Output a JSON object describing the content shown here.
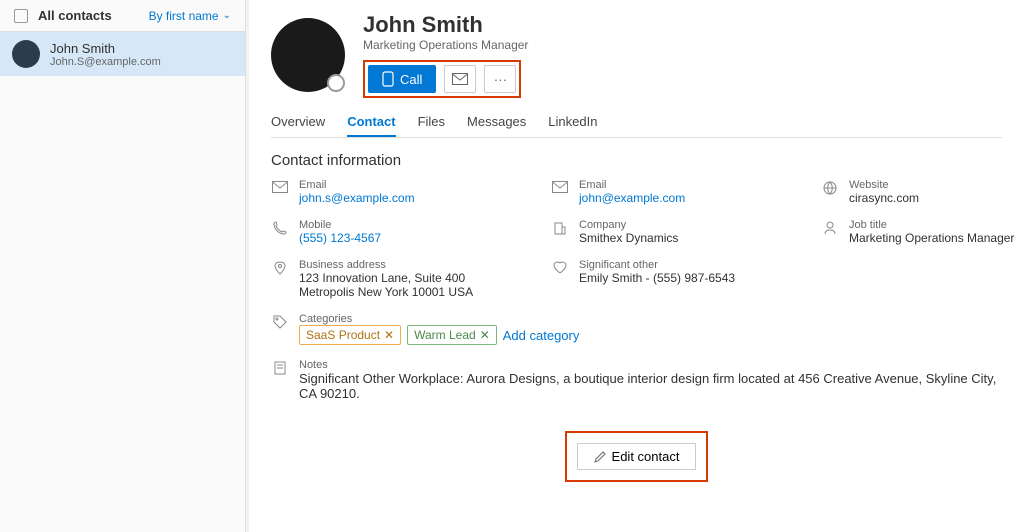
{
  "sidebar": {
    "title": "All contacts",
    "sort_label": "By first name",
    "item": {
      "name": "John Smith",
      "email": "John.S@example.com"
    }
  },
  "profile": {
    "name": "John Smith",
    "title": "Marketing Operations Manager"
  },
  "actions": {
    "call": "Call"
  },
  "tabs": [
    "Overview",
    "Contact",
    "Files",
    "Messages",
    "LinkedIn"
  ],
  "section_heading": "Contact information",
  "fields": {
    "email1_l": "Email",
    "email1_v": "john.s@example.com",
    "email2_l": "Email",
    "email2_v": "john@example.com",
    "website_l": "Website",
    "website_v": "cirasync.com",
    "mobile_l": "Mobile",
    "mobile_v": "(555) 123-4567",
    "company_l": "Company",
    "company_v": "Smithex Dynamics",
    "job_l": "Job title",
    "job_v": "Marketing Operations Manager",
    "addr_l": "Business address",
    "addr_v1": "123 Innovation Lane, Suite 400",
    "addr_v2": "Metropolis New York 10001 USA",
    "so_l": "Significant other",
    "so_v": "Emily Smith - (555) 987-6543"
  },
  "categories": {
    "label": "Categories",
    "tag1": "SaaS Product",
    "tag2": "Warm Lead",
    "add": "Add category"
  },
  "notes": {
    "label": "Notes",
    "text": "Significant Other Workplace: Aurora Designs, a boutique interior design firm located at 456 Creative Avenue, Skyline City, CA 90210."
  },
  "edit_label": "Edit contact"
}
